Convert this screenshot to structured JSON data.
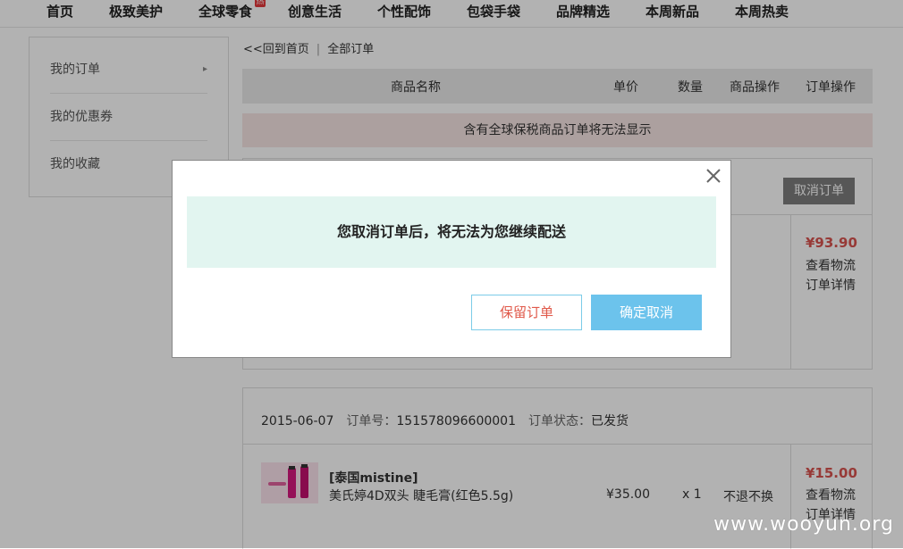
{
  "nav": {
    "items": [
      "首页",
      "极致美护",
      "全球零食",
      "创意生活",
      "个性配饰",
      "包袋手袋",
      "品牌精选",
      "本周新品",
      "本周热卖"
    ],
    "hot_badge": "热"
  },
  "sidebar": {
    "items": [
      {
        "label": "我的订单",
        "arrow": "▸"
      },
      {
        "label": "我的优惠券"
      },
      {
        "label": "我的收藏"
      }
    ]
  },
  "breadcrumb": {
    "back": "<<回到首页",
    "sep": "|",
    "current": "全部订单"
  },
  "table_header": {
    "name": "商品名称",
    "unit_price": "单价",
    "quantity": "数量",
    "product_action": "商品操作",
    "order_action": "订单操作"
  },
  "notice": "含有全球保税商品订单将无法显示",
  "order1": {
    "cancel_label": "取消订单",
    "total": "¥93.90",
    "view_logistics": "查看物流",
    "order_detail": "订单详情"
  },
  "order2": {
    "date": "2015-06-07",
    "order_no_label": "订单号：",
    "order_no": "151578096600001",
    "status_label": "订单状态：",
    "status": "已发货",
    "product_title": "[泰国mistine]",
    "product_desc": "美氏婷4D双头 睫毛膏(红色5.5g)",
    "unit_price": "¥35.00",
    "quantity": "x 1",
    "return_policy": "不退不换",
    "total": "¥15.00",
    "view_logistics": "查看物流",
    "order_detail": "订单详情"
  },
  "modal": {
    "message": "您取消订单后，将无法为您继续配送",
    "keep_label": "保留订单",
    "confirm_label": "确定取消"
  },
  "watermark": "www.wooyun.org",
  "colors": {
    "accent_price": "#d9534f",
    "confirm_button": "#6cc3ec",
    "keep_button_text": "#e0594a",
    "notice_bg": "#f7e6e4",
    "modal_message_bg": "#e2f5f0"
  }
}
